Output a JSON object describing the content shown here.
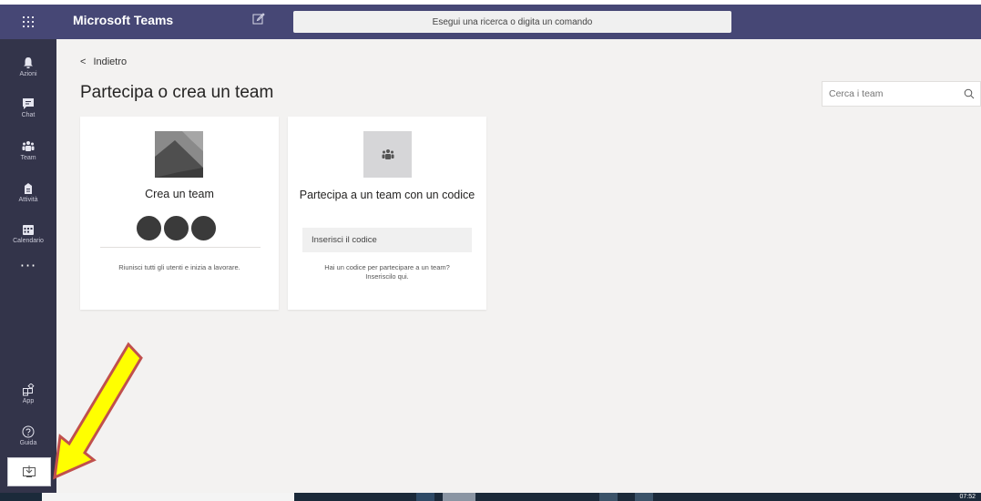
{
  "app": {
    "title": "Microsoft Teams",
    "search_placeholder": "Esegui una ricerca o digita un comando",
    "accent": "#464775",
    "rail_color": "#33344a"
  },
  "rail": {
    "items": [
      {
        "label": "Azioni",
        "icon": "bell-icon"
      },
      {
        "label": "Chat",
        "icon": "chat-icon"
      },
      {
        "label": "Team",
        "icon": "teams-icon"
      },
      {
        "label": "Attività",
        "icon": "assignments-icon"
      },
      {
        "label": "Calendario",
        "icon": "calendar-icon"
      }
    ],
    "more": "···",
    "bottom": [
      {
        "label": "App",
        "icon": "apps-icon"
      },
      {
        "label": "Guida",
        "icon": "help-icon"
      }
    ],
    "download_icon": "download-icon"
  },
  "main": {
    "back_label": "Indietro",
    "page_title": "Partecipa o crea un team",
    "team_search_placeholder": "Cerca i team",
    "create_card": {
      "title": "Crea un team",
      "description": "Riunisci tutti gli utenti e inizia a lavorare."
    },
    "join_card": {
      "title": "Partecipa a un team con un codice",
      "code_placeholder": "Inserisci il codice",
      "description_line1": "Hai un codice per partecipare a un team?",
      "description_line2": "Inseriscilo qui."
    }
  },
  "taskbar": {
    "clock": "07:52"
  },
  "annotation": {
    "arrow_color": "#ffff00",
    "arrow_outline": "#c0504d"
  }
}
